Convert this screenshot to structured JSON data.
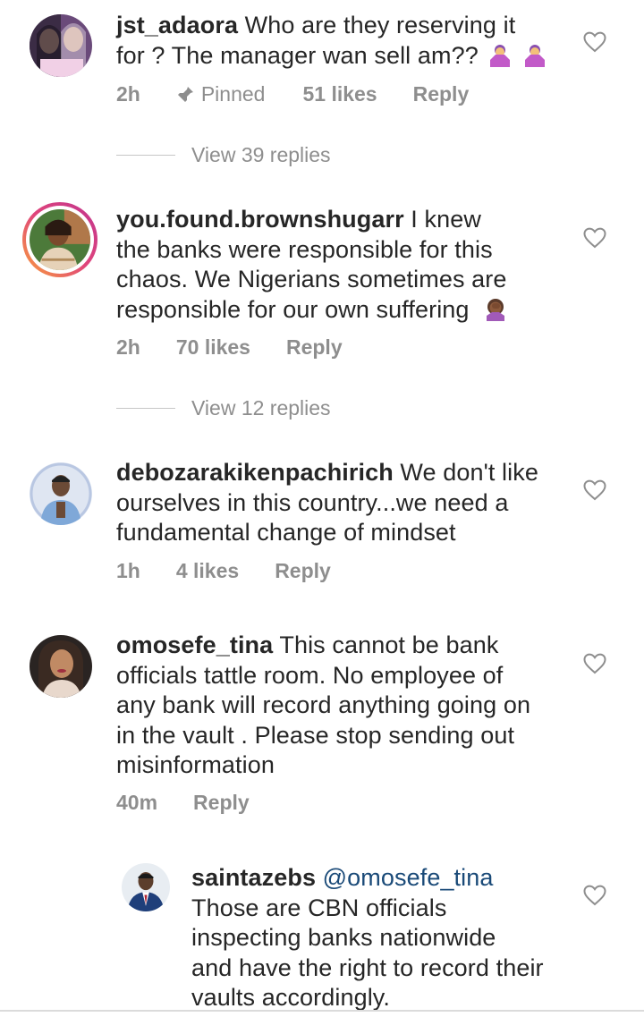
{
  "comments": [
    {
      "username": "jst_adaora",
      "text_lines": [
        " Who are they reserving it",
        "for ? The manager wan sell am??"
      ],
      "time": "2h",
      "pinned": "Pinned",
      "likes": "51 likes",
      "reply": "Reply",
      "view_replies": "View 39 replies",
      "emoji": "person-shrugging-emoji"
    },
    {
      "username": "you.found.brownshugarr",
      "text_lines": [
        " I knew",
        "the banks were responsible for this",
        "chaos. We Nigerians sometimes are",
        "responsible for our own suffering"
      ],
      "time": "2h",
      "likes": "70 likes",
      "reply": "Reply",
      "view_replies": "View 12 replies",
      "emoji": "face-palm-emoji"
    },
    {
      "username": "debozarakikenpachirich",
      "text_lines": [
        " We don't like",
        "ourselves in this country...we need a",
        "fundamental change of mindset"
      ],
      "time": "1h",
      "likes": "4 likes",
      "reply": "Reply"
    },
    {
      "username": "omosefe_tina",
      "text_lines": [
        " This cannot be bank",
        "officials tattle room. No employee of",
        "any bank will record anything going on",
        "in the vault . Please stop sending out",
        "misinformation"
      ],
      "time": "40m",
      "reply": "Reply"
    },
    {
      "username": "saintazebs",
      "mention": "@omosefe_tina",
      "text_lines": [
        "Those are CBN officials",
        "inspecting banks nationwide",
        "and have the right to record their",
        "vaults accordingly."
      ]
    }
  ],
  "colors": {
    "text": "#262626",
    "meta": "#8e8e8e",
    "mention": "#1a4a78",
    "story_ring_start": "#f9a13b",
    "story_ring_end": "#c1358e"
  },
  "icons": {
    "like": "heart-outline-icon",
    "pin": "pin-icon"
  }
}
